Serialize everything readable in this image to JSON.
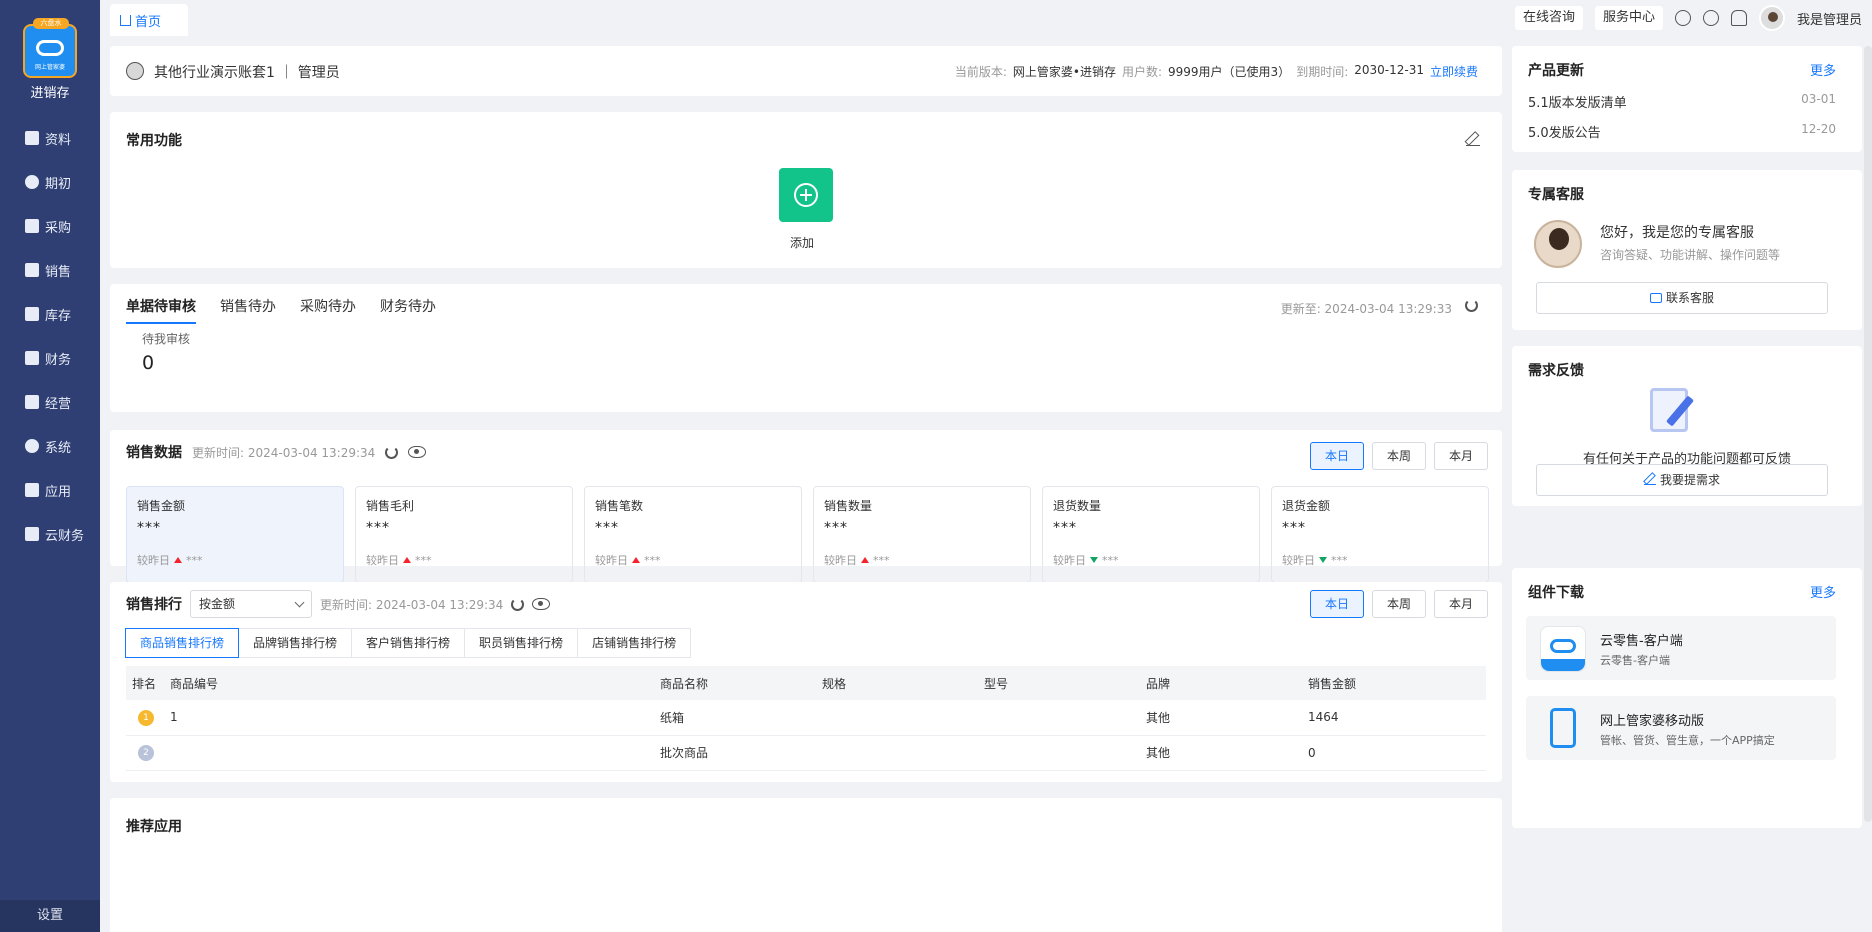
{
  "app": {
    "logo_tag": "六盘水",
    "logo_sub": "网上管家婆",
    "logo_text": "进销存"
  },
  "sidebar": {
    "items": [
      {
        "label": "资料",
        "icon": "data-icon"
      },
      {
        "label": "期初",
        "icon": "opening-icon"
      },
      {
        "label": "采购",
        "icon": "purchase-icon"
      },
      {
        "label": "销售",
        "icon": "sales-icon"
      },
      {
        "label": "库存",
        "icon": "inventory-icon"
      },
      {
        "label": "财务",
        "icon": "finance-icon"
      },
      {
        "label": "经营",
        "icon": "operation-icon"
      },
      {
        "label": "系统",
        "icon": "system-icon"
      },
      {
        "label": "应用",
        "icon": "app-icon"
      },
      {
        "label": "云财务",
        "icon": "cloud-finance-icon"
      }
    ],
    "settings": "设置"
  },
  "topbar": {
    "home_tab": "首页",
    "consult": "在线咨询",
    "service": "服务中心",
    "user": "我是管理员"
  },
  "account": {
    "name": "其他行业演示账套1 ｜ 管理员",
    "version_label": "当前版本:",
    "version": "网上管家婆•进销存",
    "users_label": "用户数:",
    "users": "9999用户（已使用3）",
    "expire_label": "到期时间:",
    "expire": "2030-12-31",
    "renew": "立即续费"
  },
  "common": {
    "title": "常用功能",
    "add_label": "添加"
  },
  "pending": {
    "tabs": [
      "单据待审核",
      "销售待办",
      "采购待办",
      "财务待办"
    ],
    "updated": "更新至: 2024-03-04 13:29:33",
    "label": "待我审核",
    "value": "0"
  },
  "sales": {
    "title": "销售数据",
    "updated": "更新时间: 2024-03-04 13:29:34",
    "ranges": [
      "本日",
      "本周",
      "本月"
    ],
    "compare_label": "较昨日",
    "metrics": [
      {
        "label": "销售金额",
        "value": "***",
        "delta": "***",
        "trend": "up"
      },
      {
        "label": "销售毛利",
        "value": "***",
        "delta": "***",
        "trend": "up"
      },
      {
        "label": "销售笔数",
        "value": "***",
        "delta": "***",
        "trend": "up"
      },
      {
        "label": "销售数量",
        "value": "***",
        "delta": "***",
        "trend": "up"
      },
      {
        "label": "退货数量",
        "value": "***",
        "delta": "***",
        "trend": "down"
      },
      {
        "label": "退货金额",
        "value": "***",
        "delta": "***",
        "trend": "down"
      }
    ]
  },
  "ranking": {
    "title": "销售排行",
    "sort_by": "按金额",
    "updated": "更新时间: 2024-03-04 13:29:34",
    "ranges": [
      "本日",
      "本周",
      "本月"
    ],
    "tabs": [
      "商品销售排行榜",
      "品牌销售排行榜",
      "客户销售排行榜",
      "职员销售排行榜",
      "店铺销售排行榜"
    ],
    "columns": [
      "排名",
      "商品编号",
      "商品名称",
      "规格",
      "型号",
      "品牌",
      "销售金额"
    ],
    "rows": [
      {
        "rank": "1",
        "code": "1",
        "name": "纸箱",
        "spec": "",
        "model": "",
        "brand": "其他",
        "amount": "1464"
      },
      {
        "rank": "2",
        "code": "",
        "name": "批次商品",
        "spec": "",
        "model": "",
        "brand": "其他",
        "amount": "0"
      }
    ]
  },
  "recommend": {
    "title": "推荐应用"
  },
  "right": {
    "updates": {
      "title": "产品更新",
      "more": "更多",
      "items": [
        {
          "text": "5.1版本发版清单",
          "date": "03-01"
        },
        {
          "text": "5.0发版公告",
          "date": "12-20"
        }
      ]
    },
    "service": {
      "title": "专属客服",
      "hello": "您好，我是您的专属客服",
      "desc": "咨询答疑、功能讲解、操作问题等",
      "button": "联系客服"
    },
    "feedback": {
      "title": "需求反馈",
      "text": "有任何关于产品的功能问题都可反馈",
      "button": "我要提需求"
    },
    "downloads": {
      "title": "组件下载",
      "more": "更多",
      "items": [
        {
          "name": "云零售-客户端",
          "sub": "云零售-客户端",
          "logo_text": "云零售"
        },
        {
          "name": "网上管家婆移动版",
          "sub": "管帐、管货、管生意，一个APP搞定"
        }
      ]
    }
  }
}
